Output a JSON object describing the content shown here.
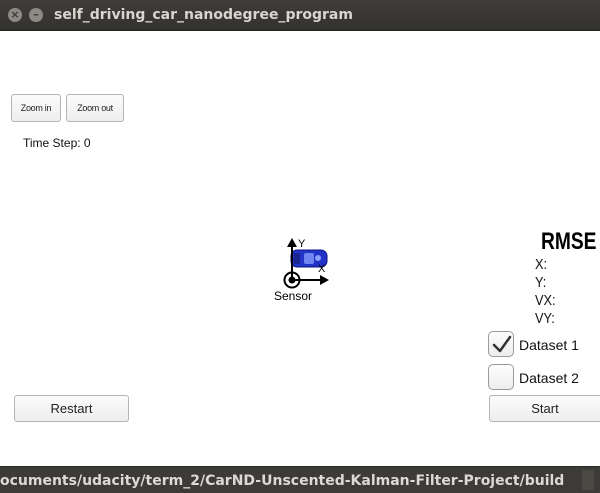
{
  "window": {
    "title": "self_driving_car_nanodegree_program",
    "close_glyph": "×",
    "minimize_glyph": "–"
  },
  "toolbar": {
    "zoom_in_label": "Zoom in",
    "zoom_out_label": "Zoom out"
  },
  "sim": {
    "time_step_label": "Time Step: 0",
    "sensor_label": "Sensor",
    "axis_y": "Y",
    "axis_x": "X",
    "car_color": "#2233c8"
  },
  "rmse": {
    "title": "RMSE",
    "x_label": "X:",
    "y_label": "Y:",
    "vx_label": "VX:",
    "vy_label": "VY:"
  },
  "datasets": {
    "dataset1_label": "Dataset 1",
    "dataset1_checked": true,
    "dataset2_label": "Dataset 2",
    "dataset2_checked": false
  },
  "controls": {
    "restart_label": "Restart",
    "start_label": "Start"
  },
  "statusbar": {
    "path_text": "ocuments/udacity/term_2/CarND-Unscented-Kalman-Filter-Project/build"
  }
}
